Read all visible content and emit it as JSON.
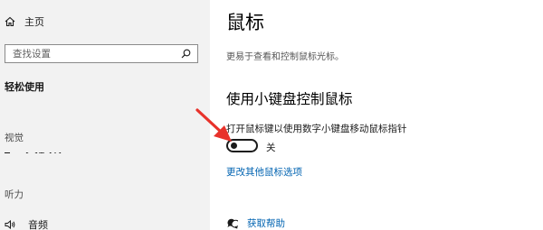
{
  "sidebar": {
    "home_label": "主页",
    "search_placeholder": "查找设置",
    "section_title": "轻松使用",
    "groups": {
      "vision": "视觉",
      "hearing": "听力"
    },
    "audio_label": "音频"
  },
  "main": {
    "title": "鼠标",
    "description": "更易于查看和控制鼠标光标。",
    "subheading": "使用小键盘控制鼠标",
    "toggle": {
      "description": "打开鼠标键以使用数字小键盘移动鼠标指针",
      "state": "关",
      "on": false
    },
    "more_link": "更改其他鼠标选项",
    "help_link": "获取帮助"
  },
  "colors": {
    "sidebar_bg": "#f2f2f2",
    "link": "#0063b1",
    "arrow": "#e8322b"
  },
  "icons": {
    "home": "home-icon",
    "search": "search-icon",
    "audio": "speaker-icon",
    "help": "help-chat-icon"
  }
}
